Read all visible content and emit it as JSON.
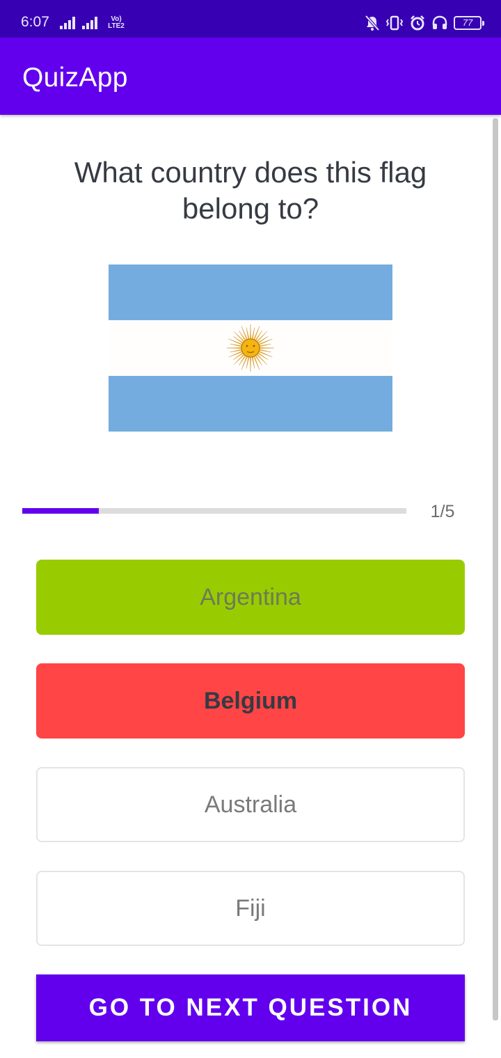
{
  "status_bar": {
    "time": "6:07",
    "network_label": "Vo) LTE2",
    "battery_level": "77",
    "icons": [
      "signal-icon",
      "signal-icon",
      "volte-icon",
      "mute-icon",
      "vibrate-icon",
      "alarm-icon",
      "headset-icon",
      "battery-icon"
    ]
  },
  "app_bar": {
    "title": "QuizApp"
  },
  "quiz": {
    "question": "What country does this flag belong to?",
    "flag_icon": "flag-argentina-icon",
    "progress": {
      "current": 1,
      "total": 5,
      "fraction": 0.2,
      "label": "1/5"
    },
    "options": [
      {
        "label": "Argentina",
        "state": "correct"
      },
      {
        "label": "Belgium",
        "state": "wrong-selected"
      },
      {
        "label": "Australia",
        "state": "default"
      },
      {
        "label": "Fiji",
        "state": "default"
      }
    ],
    "next_button_label": "GO TO NEXT QUESTION"
  },
  "colors": {
    "status_bar": "#3700b3",
    "primary": "#6200ee",
    "correct": "#99cc00",
    "wrong": "#ff4545",
    "flag_blue": "#74acdf",
    "sun": "#f6b40e"
  }
}
